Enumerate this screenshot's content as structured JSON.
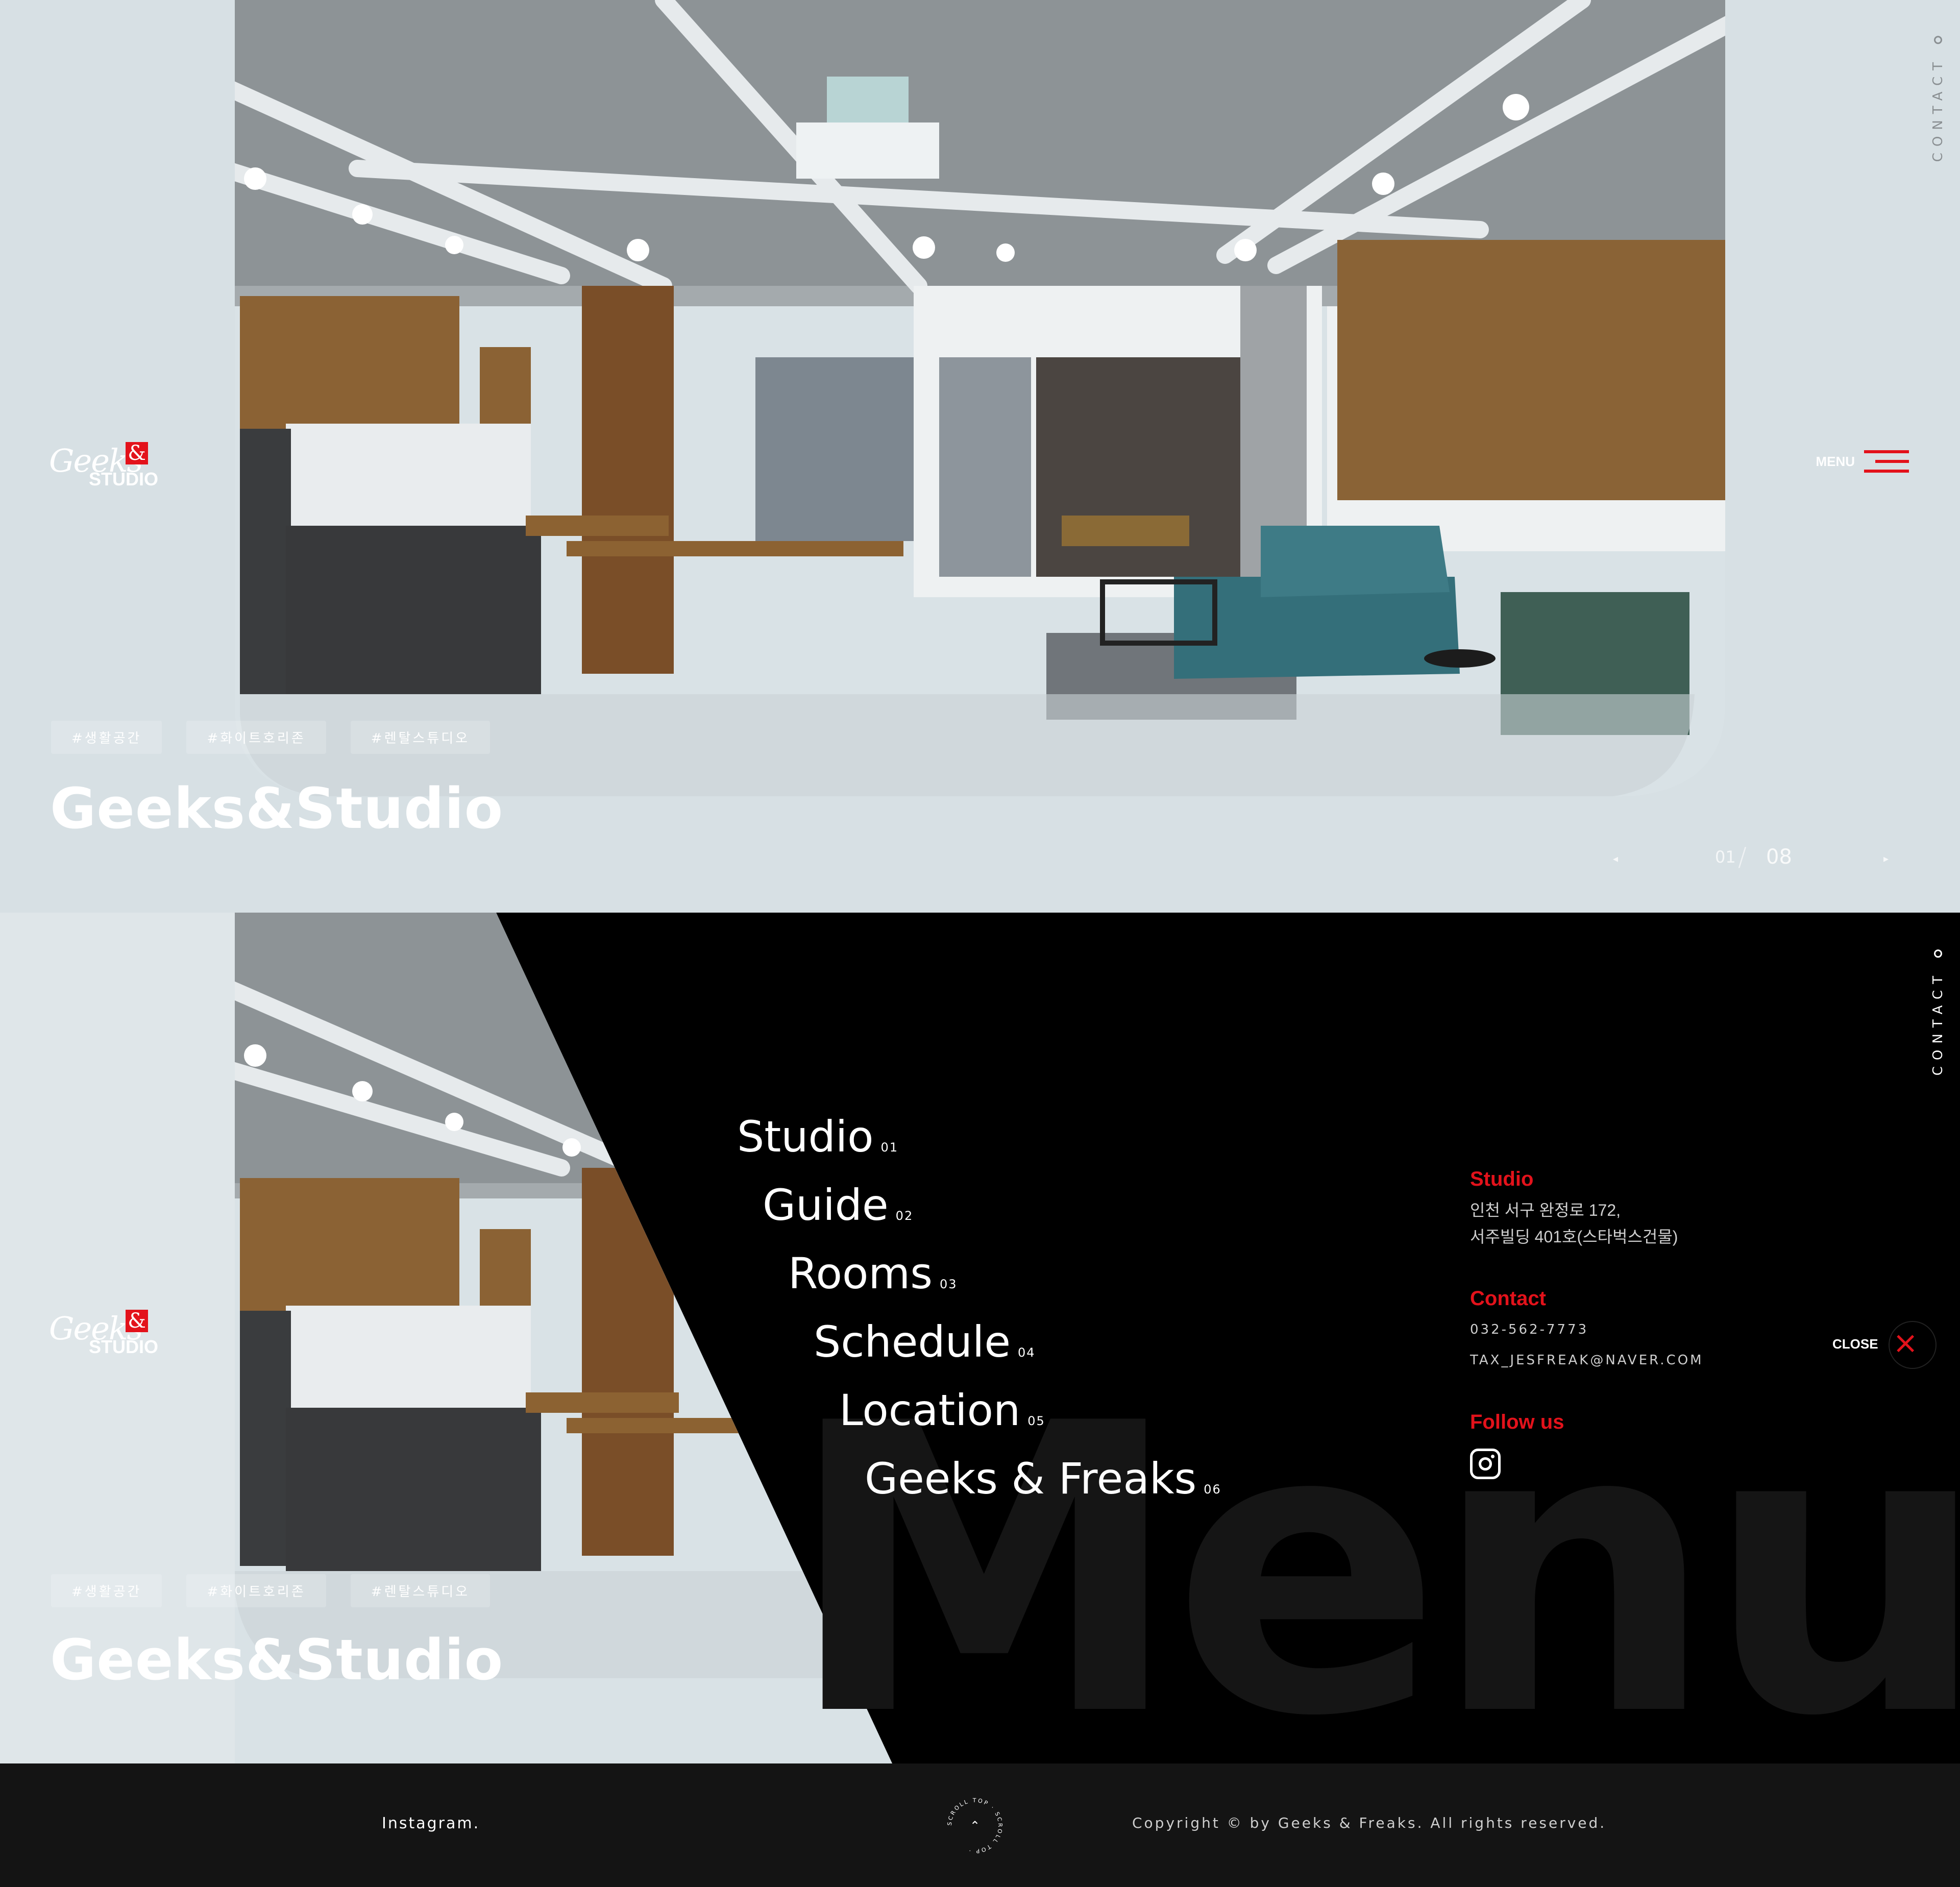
{
  "brand": {
    "logo_script": "Geeks",
    "logo_amp": "&",
    "logo_studio": "STUDIO"
  },
  "hero": {
    "tags": [
      "#생활공간",
      "#화이트호리존",
      "#렌탈스튜디오"
    ],
    "title": "Geeks&Studio",
    "side_label": "CONTACT",
    "menu_label": "MENU",
    "pager": {
      "prev": "◂",
      "next": "▸",
      "current": "01",
      "total": "08"
    }
  },
  "menu": {
    "watermark": "Menu",
    "items": [
      {
        "label": "Studio",
        "num": "01"
      },
      {
        "label": "Guide",
        "num": "02"
      },
      {
        "label": "Rooms",
        "num": "03"
      },
      {
        "label": "Schedule",
        "num": "04"
      },
      {
        "label": "Location",
        "num": "05"
      },
      {
        "label": "Geeks & Freaks",
        "num": "06"
      }
    ],
    "studio_heading": "Studio",
    "studio_address_1": "인천 서구 완정로 172,",
    "studio_address_2": "서주빌딩 401호(스타벅스건물)",
    "contact_heading": "Contact",
    "phone": "032-562-7773",
    "email": "TAX_JESFREAK@NAVER.COM",
    "follow_heading": "Follow us",
    "close_label": "CLOSE",
    "close_icon": "×"
  },
  "footer": {
    "instagram_label": "Instagram.",
    "scroll_top_label": "SCROLL TOP",
    "copyright": "Copyright © by Geeks & Freaks. All rights reserved."
  },
  "colors": {
    "accent": "#e3121b",
    "dark": "#000000",
    "footer": "#141414"
  }
}
